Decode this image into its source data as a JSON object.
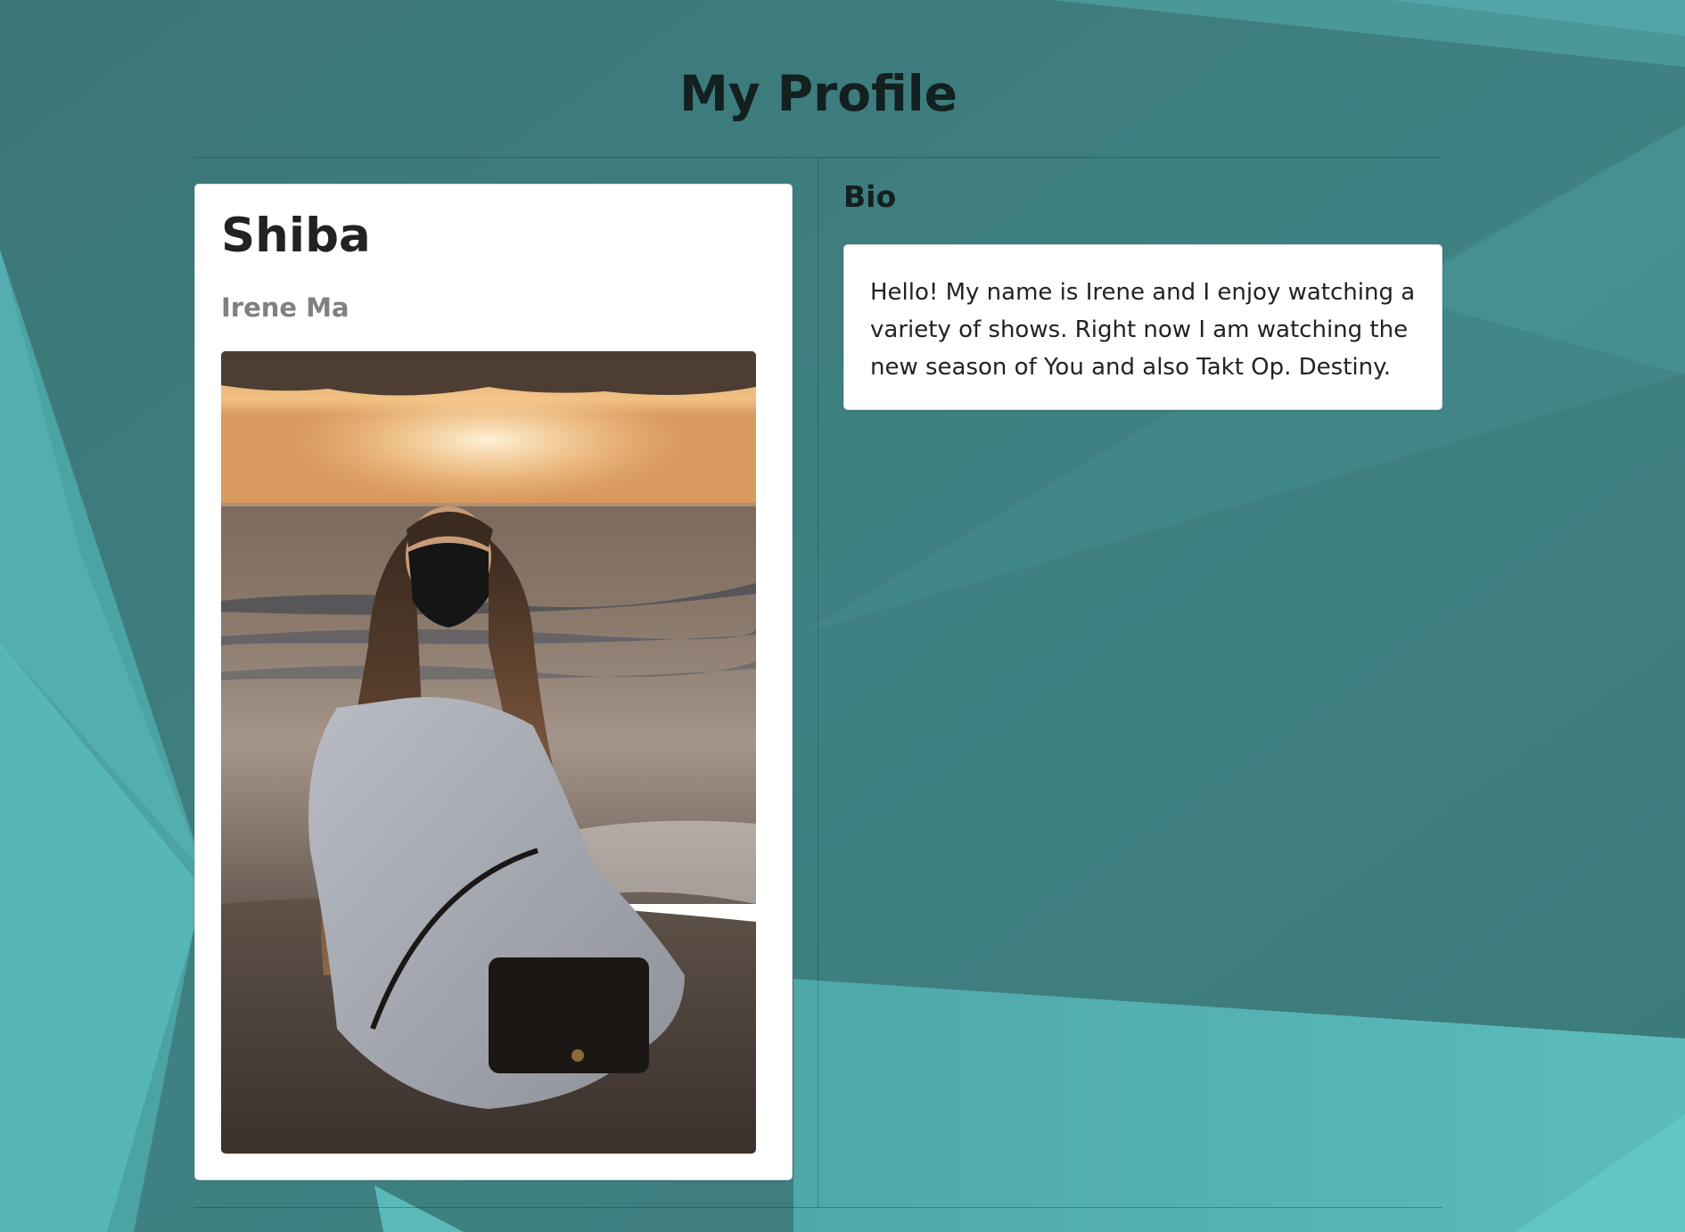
{
  "page": {
    "title": "My Profile"
  },
  "profile": {
    "username": "Shiba",
    "full_name": "Irene Ma",
    "photo_description": "woman-in-face-mask-on-beach-at-sunset"
  },
  "bio": {
    "heading": "Bio",
    "text": "Hello! My name is Irene and I enjoy watching a variety of shows. Right now I am watching the new season of You and also Takt Op. Destiny."
  },
  "colors": {
    "background": "#3d7d7e",
    "background_light": "#57b3b4",
    "card": "#ffffff",
    "title_text": "#13201f",
    "subtitle_text": "#808080"
  }
}
